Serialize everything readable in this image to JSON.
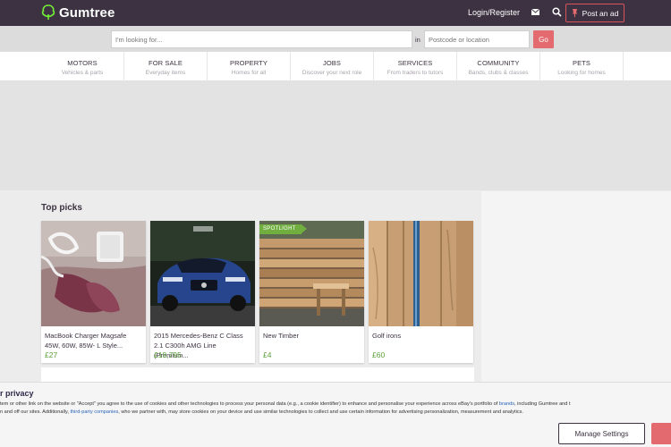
{
  "header": {
    "logo_text": "Gumtree",
    "login_label": "Login/Register",
    "post_ad_label": "Post an ad",
    "colors": {
      "bg": "#3c3241",
      "accent": "#d8535a",
      "brand_green": "#72ef36"
    }
  },
  "search": {
    "query_placeholder": "I'm looking for...",
    "in_label": "in",
    "location_placeholder": "Postcode or location",
    "go_label": "Go"
  },
  "categories": [
    {
      "title": "MOTORS",
      "subtitle": "Vehicles & parts"
    },
    {
      "title": "FOR SALE",
      "subtitle": "Everyday items"
    },
    {
      "title": "PROPERTY",
      "subtitle": "Homes for all"
    },
    {
      "title": "JOBS",
      "subtitle": "Discover your next role"
    },
    {
      "title": "SERVICES",
      "subtitle": "From traders to tutors"
    },
    {
      "title": "COMMUNITY",
      "subtitle": "Bands, clubs & classes"
    },
    {
      "title": "PETS",
      "subtitle": "Looking for homes"
    }
  ],
  "top_picks": {
    "heading": "Top picks",
    "items": [
      {
        "title": "MacBook Charger Magsafe 45W, 60W, 85W- L Style...",
        "price": "£27",
        "badge": ""
      },
      {
        "title": "2015 Mercedes-Benz C Class 2.1 C300h AMG Line (Premium...",
        "price": "£19,795",
        "badge": ""
      },
      {
        "title": "New Timber",
        "price": "£4",
        "badge": "SPOTLIGHT"
      },
      {
        "title": "Golf irons",
        "price": "£60",
        "badge": ""
      }
    ]
  },
  "cookie": {
    "title": "r privacy",
    "line1_a": "tem or other link on the website or \"Accept\" you agree to the use of cookies and other technologies to process your personal data (e.g., a cookie identifier) to enhance and personalise your experience across eBay's portfolio of ",
    "line1_link": "brands",
    "line1_b": ", including Gumtree and t",
    "line2_a": "n and off our sites. Additionally, ",
    "line2_link": "third-party companies",
    "line2_b": ", who we partner with, may store cookies on your device and use similar technologies to collect and use certain information for advertising personalization, measurement and analytics.",
    "manage_label": "Manage Settings"
  }
}
